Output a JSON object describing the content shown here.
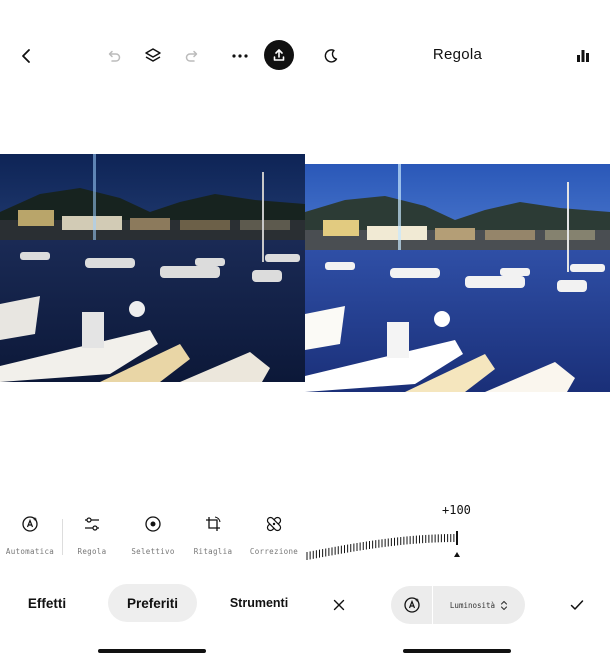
{
  "left": {
    "tools": [
      {
        "label": "Automatica",
        "icon": "auto-enhance-icon"
      },
      {
        "label": "Regola",
        "icon": "sliders-icon"
      },
      {
        "label": "Selettivo",
        "icon": "selective-target-icon"
      },
      {
        "label": "Ritaglia",
        "icon": "crop-rotate-icon"
      },
      {
        "label": "Correzione",
        "icon": "healing-bandage-icon"
      }
    ],
    "tabs": {
      "effects": "Effetti",
      "favorites": "Preferiti",
      "tools": "Strumenti"
    },
    "active_tab": "favorites"
  },
  "right": {
    "title": "Regola",
    "slider_value": "+100",
    "slider_level": 1.0,
    "adjustment_label": "Luminosità"
  },
  "colors": {
    "accent": "#111111",
    "active_tab_bg": "#eeeeee",
    "muted_text": "#777777",
    "disabled_icon": "#bbbbbb"
  }
}
